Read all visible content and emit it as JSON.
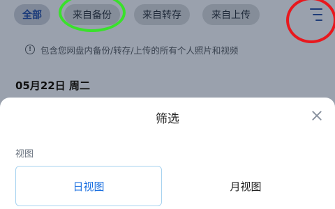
{
  "chips": [
    {
      "label": "全部",
      "active": true
    },
    {
      "label": "来自备份",
      "active": false
    },
    {
      "label": "来自转存",
      "active": false
    },
    {
      "label": "来自上传",
      "active": false
    }
  ],
  "info": {
    "icon": "info-icon",
    "text": "包含您网盘内备份/转存/上传的所有个人照片和视频"
  },
  "date_heading": "05月22日 周二",
  "sheet": {
    "title": "筛选",
    "close_icon": "close-icon",
    "section_label": "视图",
    "options": [
      {
        "label": "日视图",
        "selected": true
      },
      {
        "label": "月视图",
        "selected": false
      }
    ]
  },
  "colors": {
    "accent": "#1a6fe0",
    "annotation_green": "#39e12b",
    "annotation_red": "#e8181e"
  }
}
